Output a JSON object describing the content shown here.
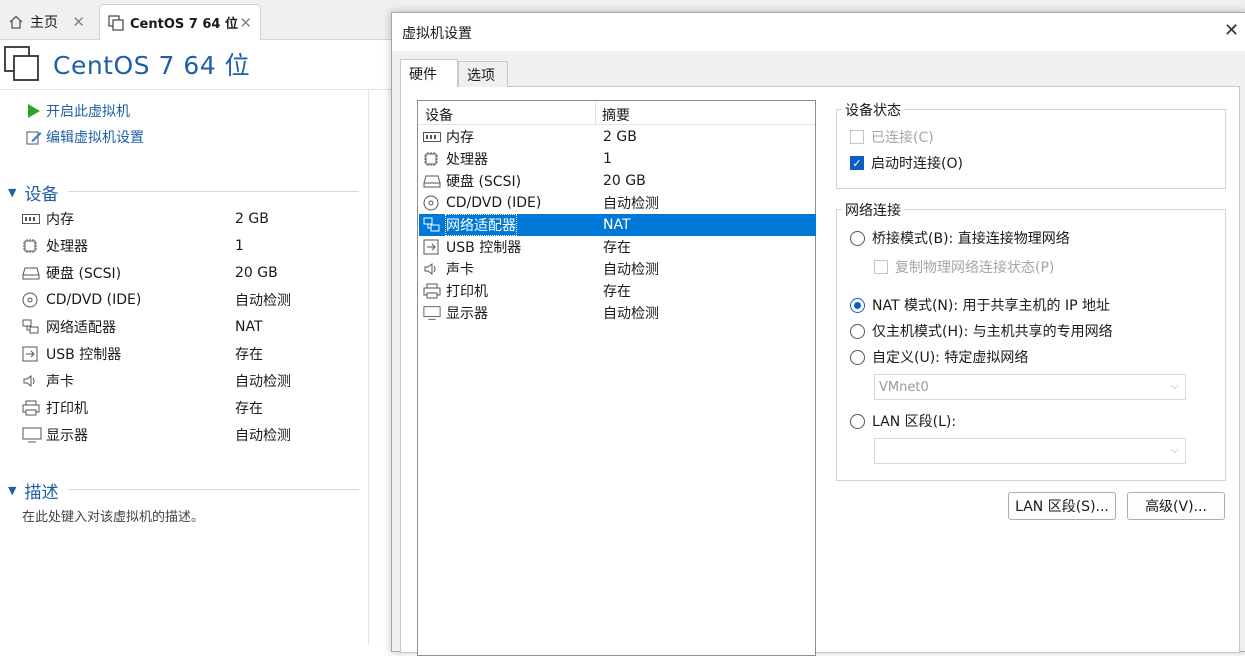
{
  "tabs": {
    "home": "主页",
    "vm": "CentOS 7 64 位"
  },
  "left": {
    "title": "CentOS 7 64 位",
    "actions": {
      "power_on": "开启此虚拟机",
      "edit_settings": "编辑虚拟机设置"
    },
    "devices_heading": "设备",
    "devices": [
      {
        "name": "内存",
        "value": "2 GB"
      },
      {
        "name": "处理器",
        "value": "1"
      },
      {
        "name": "硬盘 (SCSI)",
        "value": "20 GB"
      },
      {
        "name": "CD/DVD (IDE)",
        "value": "自动检测"
      },
      {
        "name": "网络适配器",
        "value": "NAT"
      },
      {
        "name": "USB 控制器",
        "value": "存在"
      },
      {
        "name": "声卡",
        "value": "自动检测"
      },
      {
        "name": "打印机",
        "value": "存在"
      },
      {
        "name": "显示器",
        "value": "自动检测"
      }
    ],
    "description_heading": "描述",
    "description_placeholder": "在此处键入对该虚拟机的描述。"
  },
  "dialog": {
    "title": "虚拟机设置",
    "tabs": [
      "硬件",
      "选项"
    ],
    "list_headers": {
      "device": "设备",
      "summary": "摘要"
    },
    "devices": [
      {
        "name": "内存",
        "value": "2 GB",
        "icon": "memory-icon"
      },
      {
        "name": "处理器",
        "value": "1",
        "icon": "cpu-icon"
      },
      {
        "name": "硬盘 (SCSI)",
        "value": "20 GB",
        "icon": "harddisk-icon"
      },
      {
        "name": "CD/DVD (IDE)",
        "value": "自动检测",
        "icon": "cd-icon"
      },
      {
        "name": "网络适配器",
        "value": "NAT",
        "icon": "network-icon"
      },
      {
        "name": "USB 控制器",
        "value": "存在",
        "icon": "usb-icon"
      },
      {
        "name": "声卡",
        "value": "自动检测",
        "icon": "speaker-icon"
      },
      {
        "name": "打印机",
        "value": "存在",
        "icon": "printer-icon"
      },
      {
        "name": "显示器",
        "value": "自动检测",
        "icon": "monitor-icon"
      }
    ],
    "selected_device": "网络适配器",
    "device_status": {
      "title": "设备状态",
      "connected": "已连接(C)",
      "connect_at_power_on": "启动时连接(O)"
    },
    "network": {
      "title": "网络连接",
      "bridged": "桥接模式(B): 直接连接物理网络",
      "replicate": "复制物理网络连接状态(P)",
      "nat": "NAT 模式(N): 用于共享主机的 IP 地址",
      "host_only": "仅主机模式(H): 与主机共享的专用网络",
      "custom": "自定义(U): 特定虚拟网络",
      "custom_value": "VMnet0",
      "lan_segment": "LAN 区段(L):",
      "lan_value": "",
      "selected": "nat"
    },
    "buttons": {
      "lan_segments": "LAN 区段(S)...",
      "advanced": "高级(V)..."
    }
  },
  "colors": {
    "accent": "#1f5fa8",
    "selection": "#0078d7"
  }
}
